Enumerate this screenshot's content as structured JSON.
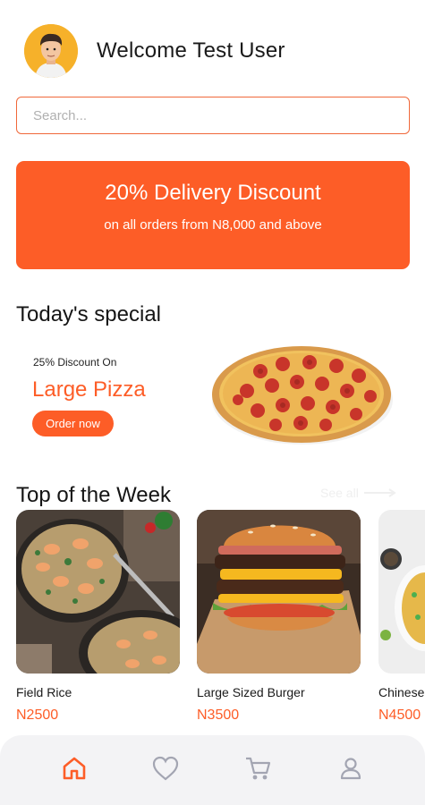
{
  "header": {
    "welcome_text": "Welcome Test User"
  },
  "search": {
    "placeholder": "Search..."
  },
  "promo": {
    "title": "20% Delivery Discount",
    "subtitle": "on all orders from N8,000 and above"
  },
  "special": {
    "section_title": "Today's special",
    "discount_text": "25% Discount On",
    "item_name": "Large Pizza",
    "order_label": "Order now"
  },
  "top_week": {
    "section_title": "Top of the Week",
    "see_all_label": "See all",
    "items": [
      {
        "name": "Field Rice",
        "price": "N2500"
      },
      {
        "name": "Large Sized Burger",
        "price": "N3500"
      },
      {
        "name": "Chinese",
        "price": "N4500"
      }
    ]
  },
  "bottom_nav": {
    "items": [
      "home-icon",
      "heart-icon",
      "cart-icon",
      "profile-icon"
    ],
    "active": "home-icon"
  },
  "colors": {
    "accent": "#fd5d27",
    "nav_background": "#f3f3f5",
    "inactive_icon": "#a3a5b2"
  }
}
